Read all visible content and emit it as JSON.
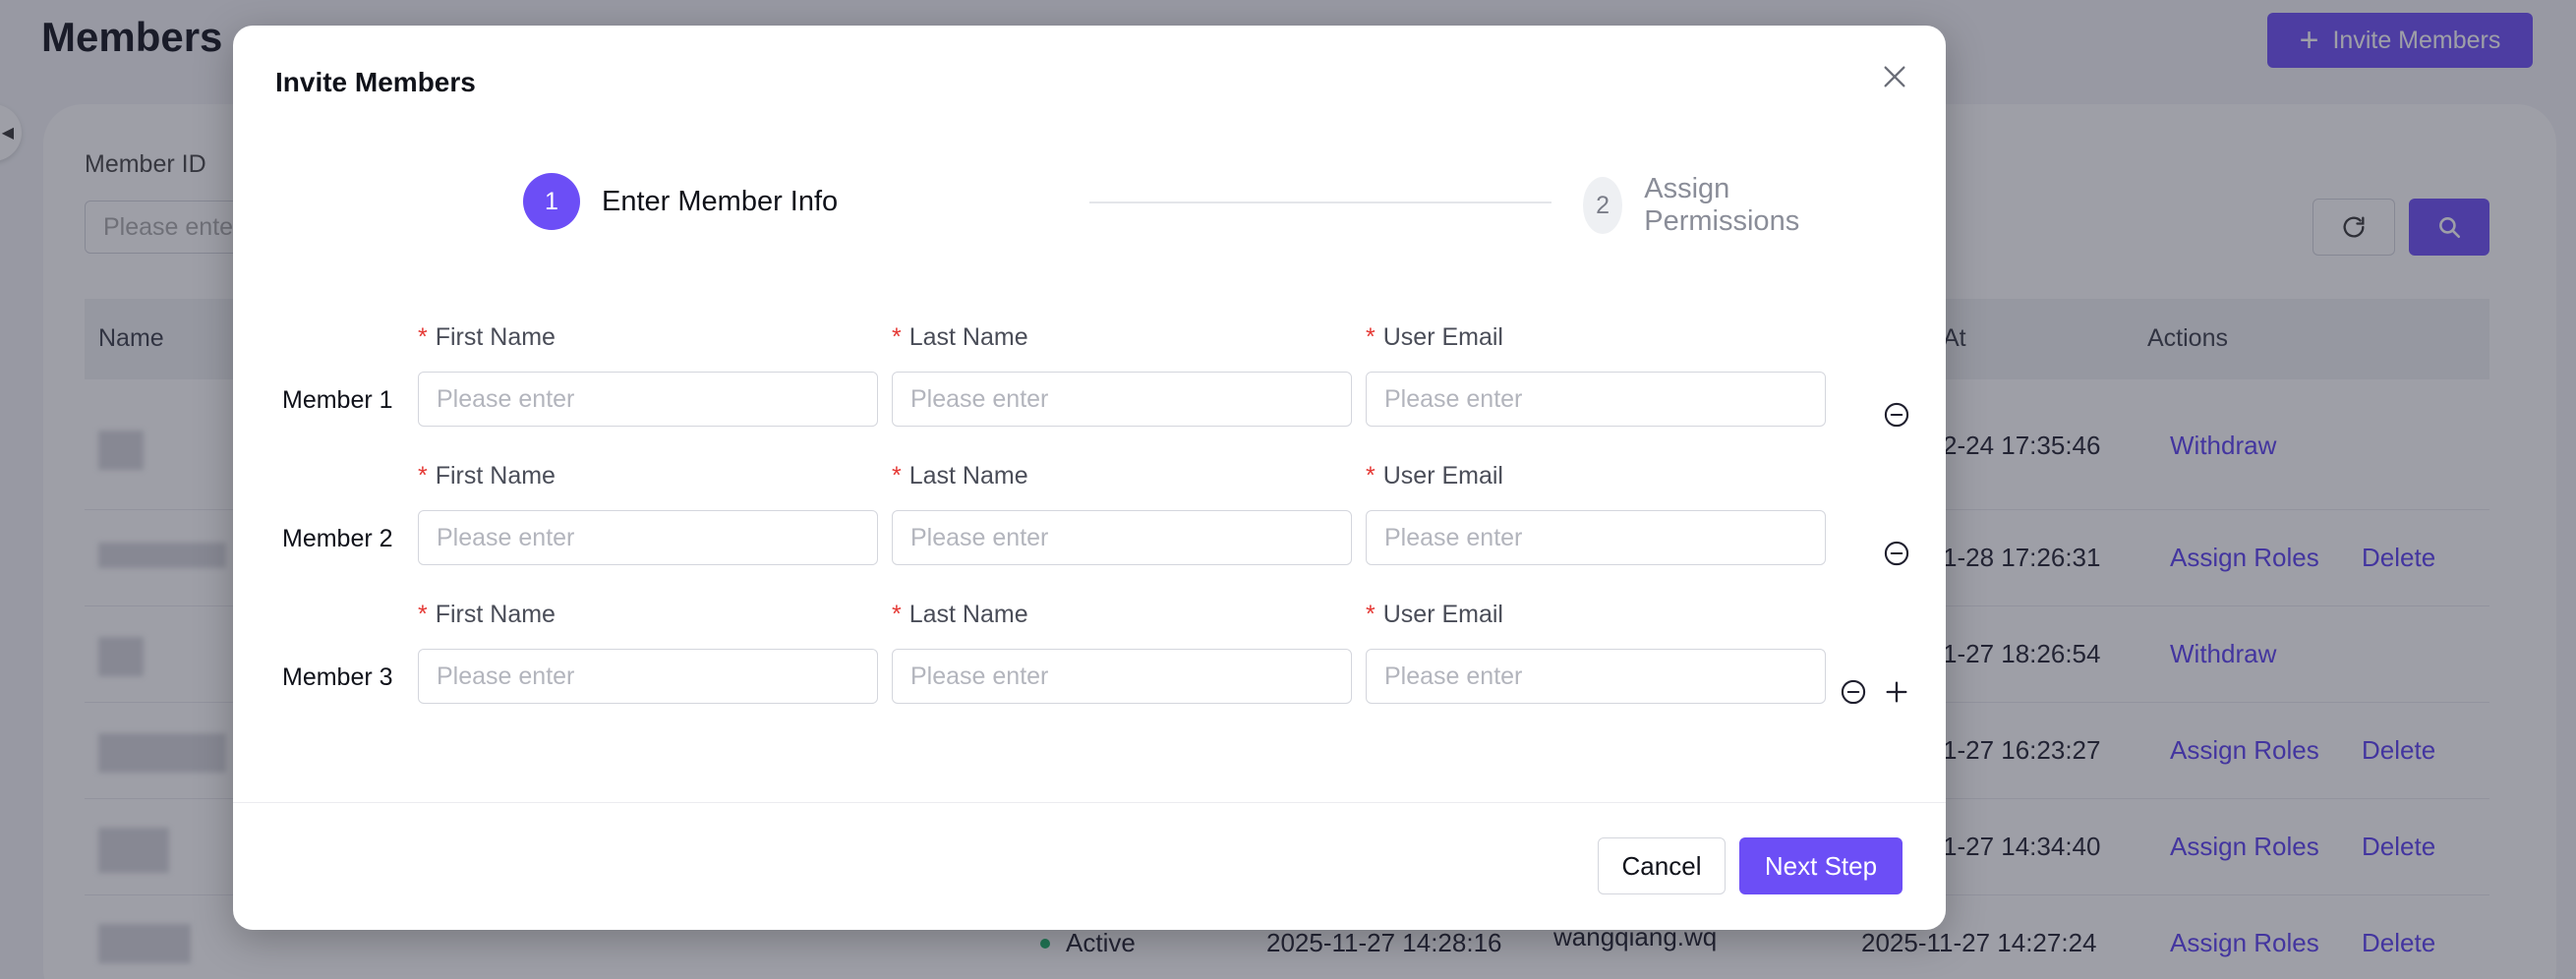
{
  "background": {
    "page_title": "Members",
    "invite_button_label": "Invite Members",
    "filter_label": "Member ID",
    "filter_placeholder": "Please enter",
    "table_headers": {
      "name": "Name",
      "at": "At",
      "actions": "Actions"
    },
    "rows": [
      {
        "time": "2-24 17:35:46",
        "actions": [
          "Withdraw"
        ]
      },
      {
        "time": "1-28 17:26:31",
        "actions": [
          "Assign Roles",
          "Delete"
        ]
      },
      {
        "time": "1-27 18:26:54",
        "actions": [
          "Withdraw"
        ]
      },
      {
        "time": "1-27 16:23:27",
        "actions": [
          "Assign Roles",
          "Delete"
        ]
      },
      {
        "time": "1-27 14:34:40",
        "actions": [
          "Assign Roles",
          "Delete"
        ]
      },
      {
        "time": "2025-11-27 14:27:24",
        "status": "Active",
        "joined": "2025-11-27 14:28:16",
        "user": "wangqiang.wq",
        "actions": [
          "Assign Roles",
          "Delete"
        ]
      }
    ]
  },
  "modal": {
    "title": "Invite Members",
    "steps": [
      {
        "number": "1",
        "label": "Enter Member Info",
        "state": "active"
      },
      {
        "number": "2",
        "label": "Assign Permissions",
        "state": "inactive"
      }
    ],
    "members": [
      {
        "label": "Member 1",
        "first_name": "",
        "last_name": "",
        "email": ""
      },
      {
        "label": "Member 2",
        "first_name": "",
        "last_name": "",
        "email": ""
      },
      {
        "label": "Member 3",
        "first_name": "",
        "last_name": "",
        "email": ""
      }
    ],
    "field_labels": {
      "first_name": "First Name",
      "last_name": "Last Name",
      "email": "User Email"
    },
    "required_marker": "*",
    "placeholder": "Please enter",
    "cancel_label": "Cancel",
    "next_label": "Next Step"
  },
  "colors": {
    "accent": "#6c4ef6",
    "required": "#e53935",
    "link": "#5a3ff0",
    "status_active": "#1db46a"
  },
  "icons": {
    "close": "close-icon",
    "remove": "minus-circle-icon",
    "add": "plus-icon",
    "refresh": "refresh-icon",
    "search": "search-icon"
  }
}
